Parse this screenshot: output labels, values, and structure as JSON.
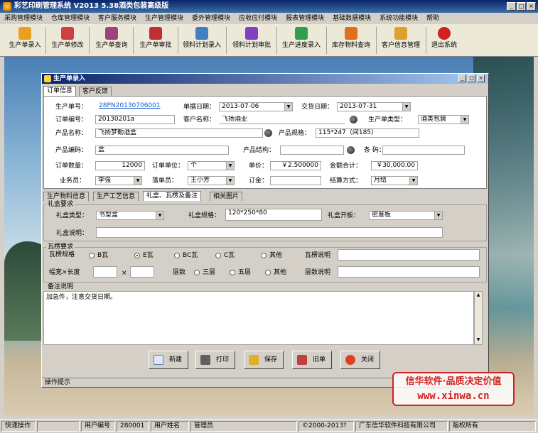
{
  "app": {
    "title": "彩艺印刷管理系统   V2013 5.38酒类包装高级版"
  },
  "menu": [
    "采购管理模块",
    "仓库管理模块",
    "客户服务模块",
    "生产管理模块",
    "委外管理模块",
    "应收应付模块",
    "报表管理模块",
    "基础数据模块",
    "系统功能模块",
    "帮助"
  ],
  "toolbar": [
    "生产单录入",
    "生产单修改",
    "生产单查询",
    "生产单审批",
    "领料计划录入",
    "领料计划审批",
    "生产进度录入",
    "库存物料查询",
    "客户信息管理",
    "退出系统"
  ],
  "window": {
    "title": "生产单录入"
  },
  "tabs_top": [
    "订单信息",
    "客户反馈"
  ],
  "order": {
    "prod_no_label": "生产单号：",
    "prod_no": "28PN20130706001",
    "doc_date_label": "单据日期：",
    "doc_date": "2013-07-06",
    "delivery_label": "交货日期：",
    "delivery": "2013-07-31",
    "order_no_label": "订单编号：",
    "order_no": "20130201a",
    "customer_label": "客户名称：",
    "customer": "飞扬酒业",
    "type_label": "生产单类型：",
    "type": "酒类包装",
    "product_label": "产品名称：",
    "product": "飞扬梦勤酒盒",
    "spec_label": "产品规格：",
    "spec": "115*247（间185）",
    "code_label": "产品编码：",
    "code": "盒",
    "struct_label": "产品结构：",
    "struct": "",
    "barcode_label": "条  码：",
    "barcode": "",
    "qty_label": "订单数量：",
    "qty": "12000",
    "unit_label": "订单单位：",
    "unit": "个",
    "price_label": "单价：",
    "price": "￥2.500000",
    "amount_label": "金额合计：",
    "amount": "￥30,000.00",
    "sales_label": "业务员：",
    "sales": "李强",
    "drafter_label": "落单员：",
    "drafter": "王小芳",
    "deposit_label": "订金：",
    "deposit": "",
    "settle_label": "结算方式：",
    "settle": "月结"
  },
  "tabs_mid": [
    "生产物料信息",
    "生产工艺信息",
    "礼盒、瓦楞及备注",
    "相关图片"
  ],
  "giftbox": {
    "group_title": "礼盒要求",
    "type_label": "礼盒类型：",
    "type": "书型盒",
    "spec_label": "礼盒规格：",
    "spec": "120*250*80",
    "open_label": "礼盒开板：",
    "open": "密度板",
    "desc_label": "礼盒说明：",
    "desc": ""
  },
  "flute": {
    "group_title": "瓦楞要求",
    "spec_label": "瓦楞规格",
    "options": [
      "B瓦",
      "E瓦",
      "BC瓦",
      "C瓦",
      "其他"
    ],
    "selected": "E瓦",
    "desc_label": "瓦楞说明",
    "size_label": "幅宽×长度",
    "times": "×",
    "layers_label": "层数",
    "layers": [
      "三层",
      "五层",
      "其他"
    ],
    "layers_desc_label": "层数说明"
  },
  "remarks": {
    "group_title": "备注说明",
    "text": "加急件，注意交货日期。"
  },
  "buttons": [
    "新建",
    "打印",
    "保存",
    "旧单",
    "关闭"
  ],
  "hint": "操作提示",
  "watermark": {
    "line1": "信华软件·品质决定价值",
    "line2": "www.xinwa.cn"
  },
  "status": {
    "quick": "快速操作",
    "user_no_label": "用户编号",
    "user_no": "280001",
    "user_name_label": "用户姓名",
    "user_name": "管理员",
    "copyright": "©2000-2013?",
    "company": "广东信华软件科技有限公司",
    "rights": "版权所有"
  },
  "colors": {
    "title_bar": "#0a246a",
    "link": "#1a5fd0",
    "watermark": "#d42020"
  }
}
